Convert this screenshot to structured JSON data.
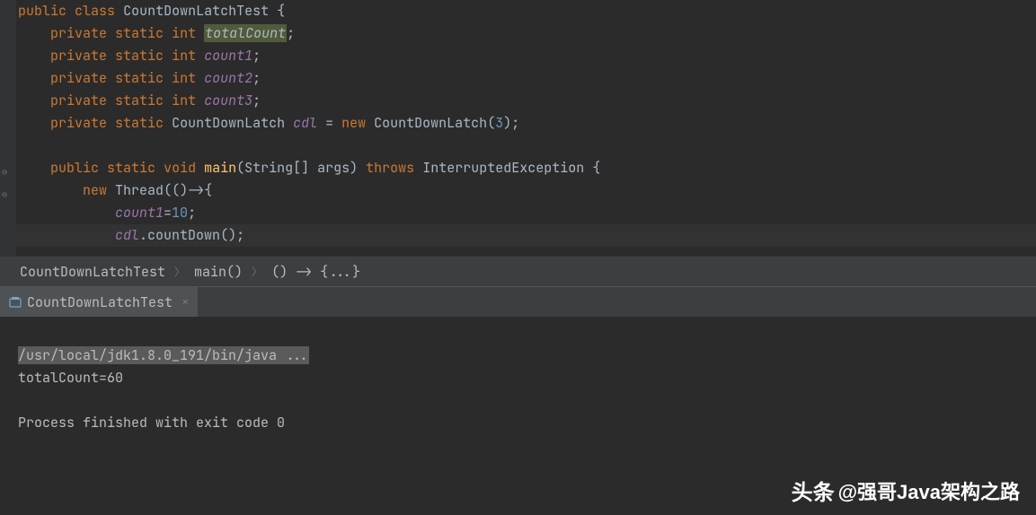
{
  "code": {
    "l1": "public class CountDownLatchTest {",
    "l2": "    private static int totalCount;",
    "l3": "    private static int count1;",
    "l4": "    private static int count2;",
    "l5": "    private static int count3;",
    "l6": "    private static CountDownLatch cdl = new CountDownLatch(3);",
    "l7": "",
    "l8": "    public static void main(String[] args) throws InterruptedException {",
    "l9": "        new Thread(()->{",
    "l10": "            count1=10;",
    "l11": "            cdl.countDown();"
  },
  "tokens": {
    "public": "public",
    "class": "class",
    "classname": "CountDownLatchTest",
    "private": "private",
    "static": "static",
    "int": "int",
    "totalCount": "totalCount",
    "count1": "count1",
    "count2": "count2",
    "count3": "count3",
    "cdl": "cdl",
    "cdlType": "CountDownLatch",
    "new": "new",
    "three": "3",
    "void": "void",
    "main": "main",
    "stringArr": "String[] args",
    "throws": "throws",
    "exception": "InterruptedException",
    "thread": "Thread",
    "arrow": "()->",
    "ten": "10",
    "countDown": "countDown"
  },
  "breadcrumb": {
    "item1": "CountDownLatchTest",
    "item2": "main()",
    "item3": "() -> {...}"
  },
  "runTab": {
    "label": "CountDownLatchTest"
  },
  "console": {
    "cmd": "/usr/local/jdk1.8.0_191/bin/java ...",
    "out1": "totalCount=60",
    "blank": "",
    "out2": "Process finished with exit code 0"
  },
  "watermark": {
    "logo": "头条",
    "text": "@强哥Java架构之路"
  }
}
